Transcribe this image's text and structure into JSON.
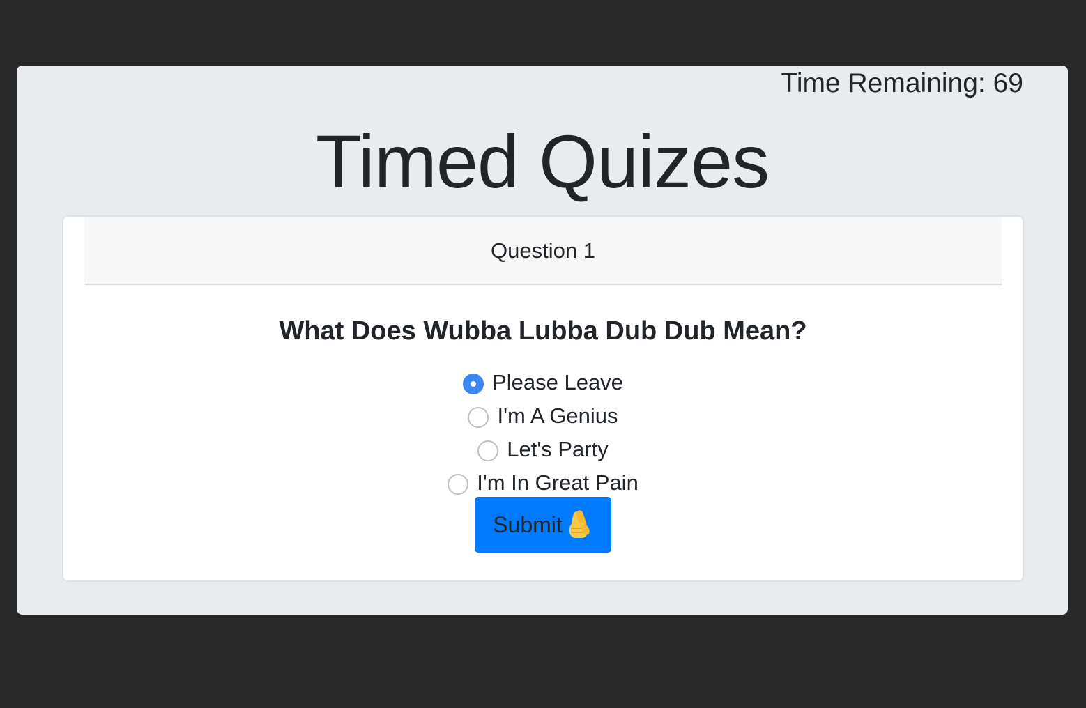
{
  "timer": {
    "label": "Time Remaining:",
    "value": "69"
  },
  "page_title": "Timed Quizes",
  "card": {
    "header": "Question 1",
    "question": "What Does Wubba Lubba Dub Dub Mean?",
    "options": [
      {
        "label": "Please Leave",
        "selected": true
      },
      {
        "label": "I'm A Genius",
        "selected": false
      },
      {
        "label": "Let's Party",
        "selected": false
      },
      {
        "label": "I'm In Great Pain",
        "selected": false
      }
    ],
    "submit_label": "Submit",
    "submit_icon": "crossed-fingers-icon"
  },
  "colors": {
    "background": "#282828",
    "panel": "#e9ecef",
    "accent": "#007bff",
    "radio_checked": "#3b88f5"
  }
}
